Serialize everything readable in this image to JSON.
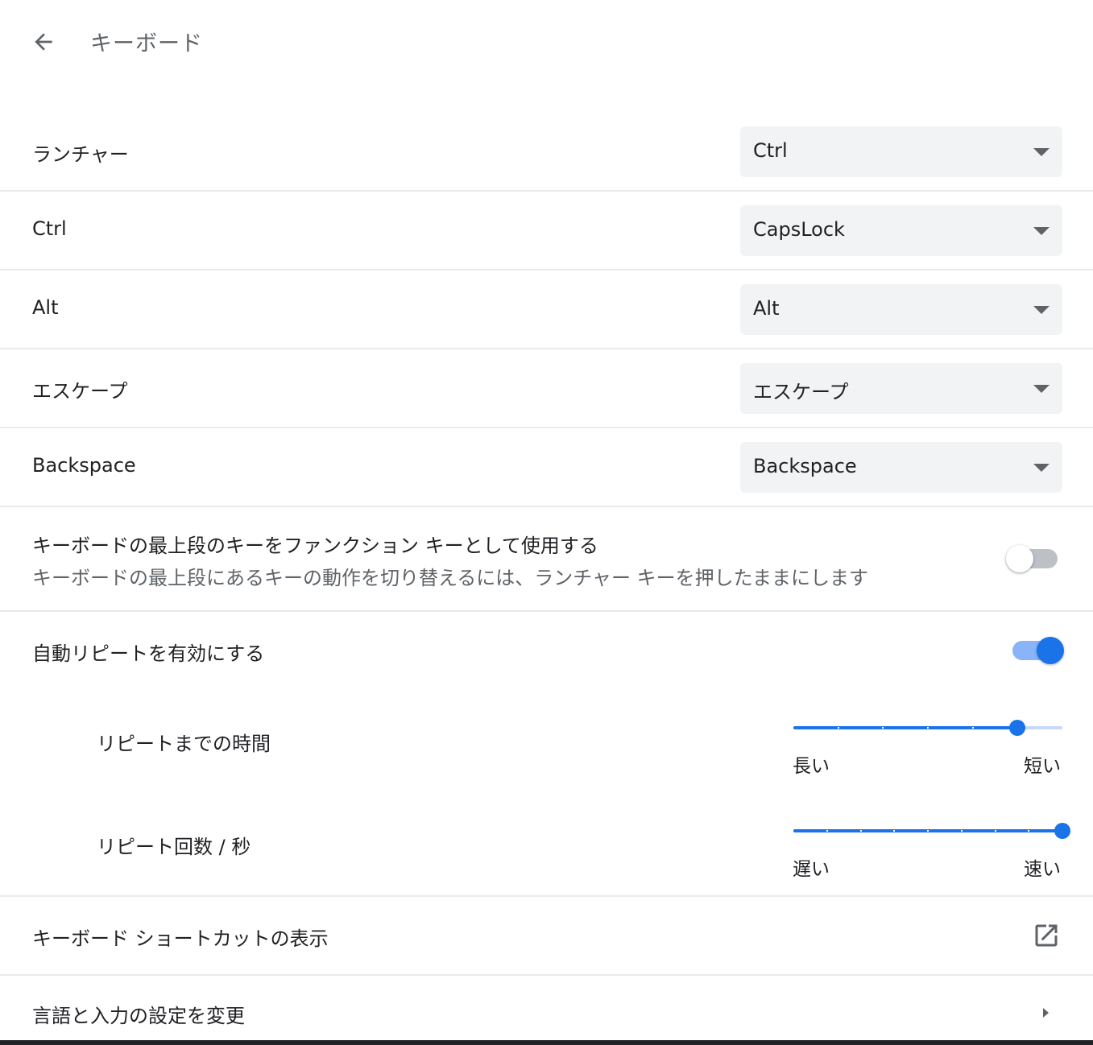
{
  "header": {
    "back_icon": "arrow-back-icon",
    "title": "キーボード"
  },
  "remaps": [
    {
      "label": "ランチャー",
      "value": "Ctrl"
    },
    {
      "label": "Ctrl",
      "value": "CapsLock"
    },
    {
      "label": "Alt",
      "value": "Alt"
    },
    {
      "label": "エスケープ",
      "value": "エスケープ"
    },
    {
      "label": "Backspace",
      "value": "Backspace"
    }
  ],
  "function_keys": {
    "label": "キーボードの最上段のキーをファンクション キーとして使用する",
    "description": "キーボードの最上段にあるキーの動作を切り替えるには、ランチャー キーを押したままにします",
    "enabled": false
  },
  "auto_repeat": {
    "label": "自動リピートを有効にする",
    "enabled": true,
    "delay": {
      "label": "リピートまでの時間",
      "min_label": "長い",
      "max_label": "短い",
      "steps": 7,
      "value_step": 5
    },
    "rate": {
      "label": "リピート回数 / 秒",
      "min_label": "遅い",
      "max_label": "速い",
      "steps": 9,
      "value_step": 8
    }
  },
  "shortcuts": {
    "label": "キーボード ショートカットの表示",
    "icon": "open-in-new-icon"
  },
  "language": {
    "label": "言語と入力の設定を変更",
    "icon": "arrow-right-icon"
  },
  "colors": {
    "accent": "#1a73e8",
    "accent_light": "#8ab4f8",
    "select_bg": "#f1f3f4",
    "divider": "#e8eaed",
    "secondary_text": "#5f6368"
  }
}
